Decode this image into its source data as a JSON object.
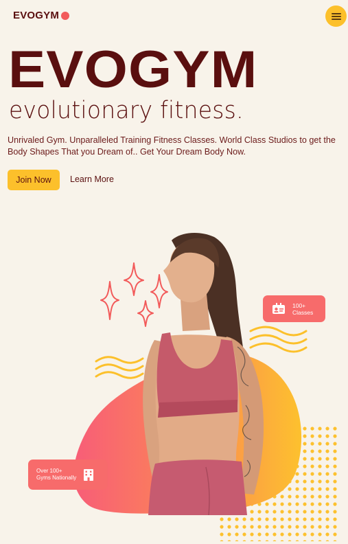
{
  "header": {
    "logo_text": "EVOGYM",
    "menu_icon": "hamburger-menu-icon"
  },
  "hero": {
    "title": "EVOGYM",
    "subtitle": "evolutionary fitness.",
    "description": "Unrivaled Gym. Unparalleled Training Fitness Classes. World Class Studios to get the Body Shapes That you Dream of.. Get Your Dream Body Now.",
    "join_label": "Join Now",
    "learn_label": "Learn More"
  },
  "badges": {
    "classes": {
      "line1": "100+",
      "line2": "Classes",
      "icon": "id-card-icon"
    },
    "gyms": {
      "line1": "Over 100+",
      "line2": "Gyms Nationally",
      "icon": "building-icon"
    }
  },
  "colors": {
    "background": "#f8f3ea",
    "brand_dark": "#5a0f0f",
    "accent_yellow": "#fcc02b",
    "accent_coral": "#f76b6b"
  }
}
